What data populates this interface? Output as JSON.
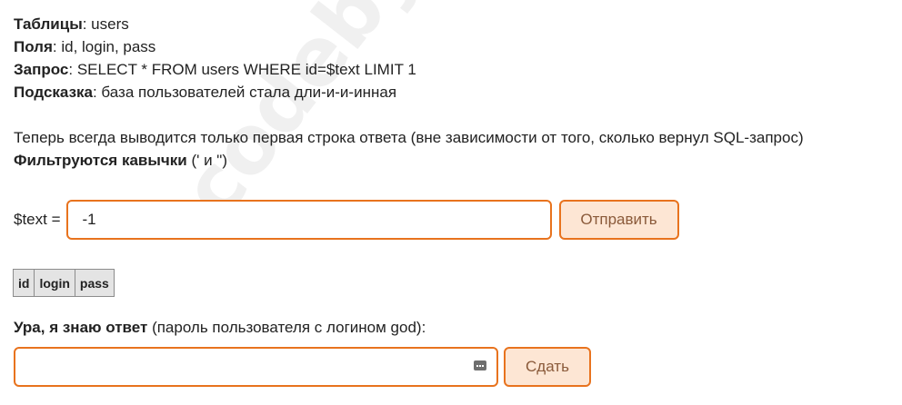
{
  "watermark": "codeby.net",
  "info": {
    "tables_label": "Таблицы",
    "tables_value": ": users",
    "fields_label": "Поля",
    "fields_value": ": id, login, pass",
    "query_label": "Запрос",
    "query_value": ": SELECT * FROM users WHERE id=$text LIMIT 1",
    "hint_label": "Подсказка",
    "hint_value": ": база пользователей стала дли-и-и-инная"
  },
  "description": {
    "line1": "Теперь всегда выводится только первая строка ответа (вне зависимости от того, сколько вернул SQL-запрос)",
    "filter_label": "Фильтруются кавычки",
    "filter_value": " (' и \")"
  },
  "query_form": {
    "label": "$text =",
    "input_value": "-1",
    "submit_label": "Отправить"
  },
  "result_table": {
    "columns": [
      "id",
      "login",
      "pass"
    ]
  },
  "answer": {
    "label": "Ура, я знаю ответ",
    "hint": " (пароль пользователя с логином god):",
    "input_value": "",
    "submit_label": "Сдать"
  },
  "icons": {
    "password_manager": "password-key-icon"
  },
  "colors": {
    "accent": "#e8731e",
    "button_bg": "#fde6d4",
    "button_text": "#8a5a3a",
    "table_bg": "#e4e4e4"
  }
}
